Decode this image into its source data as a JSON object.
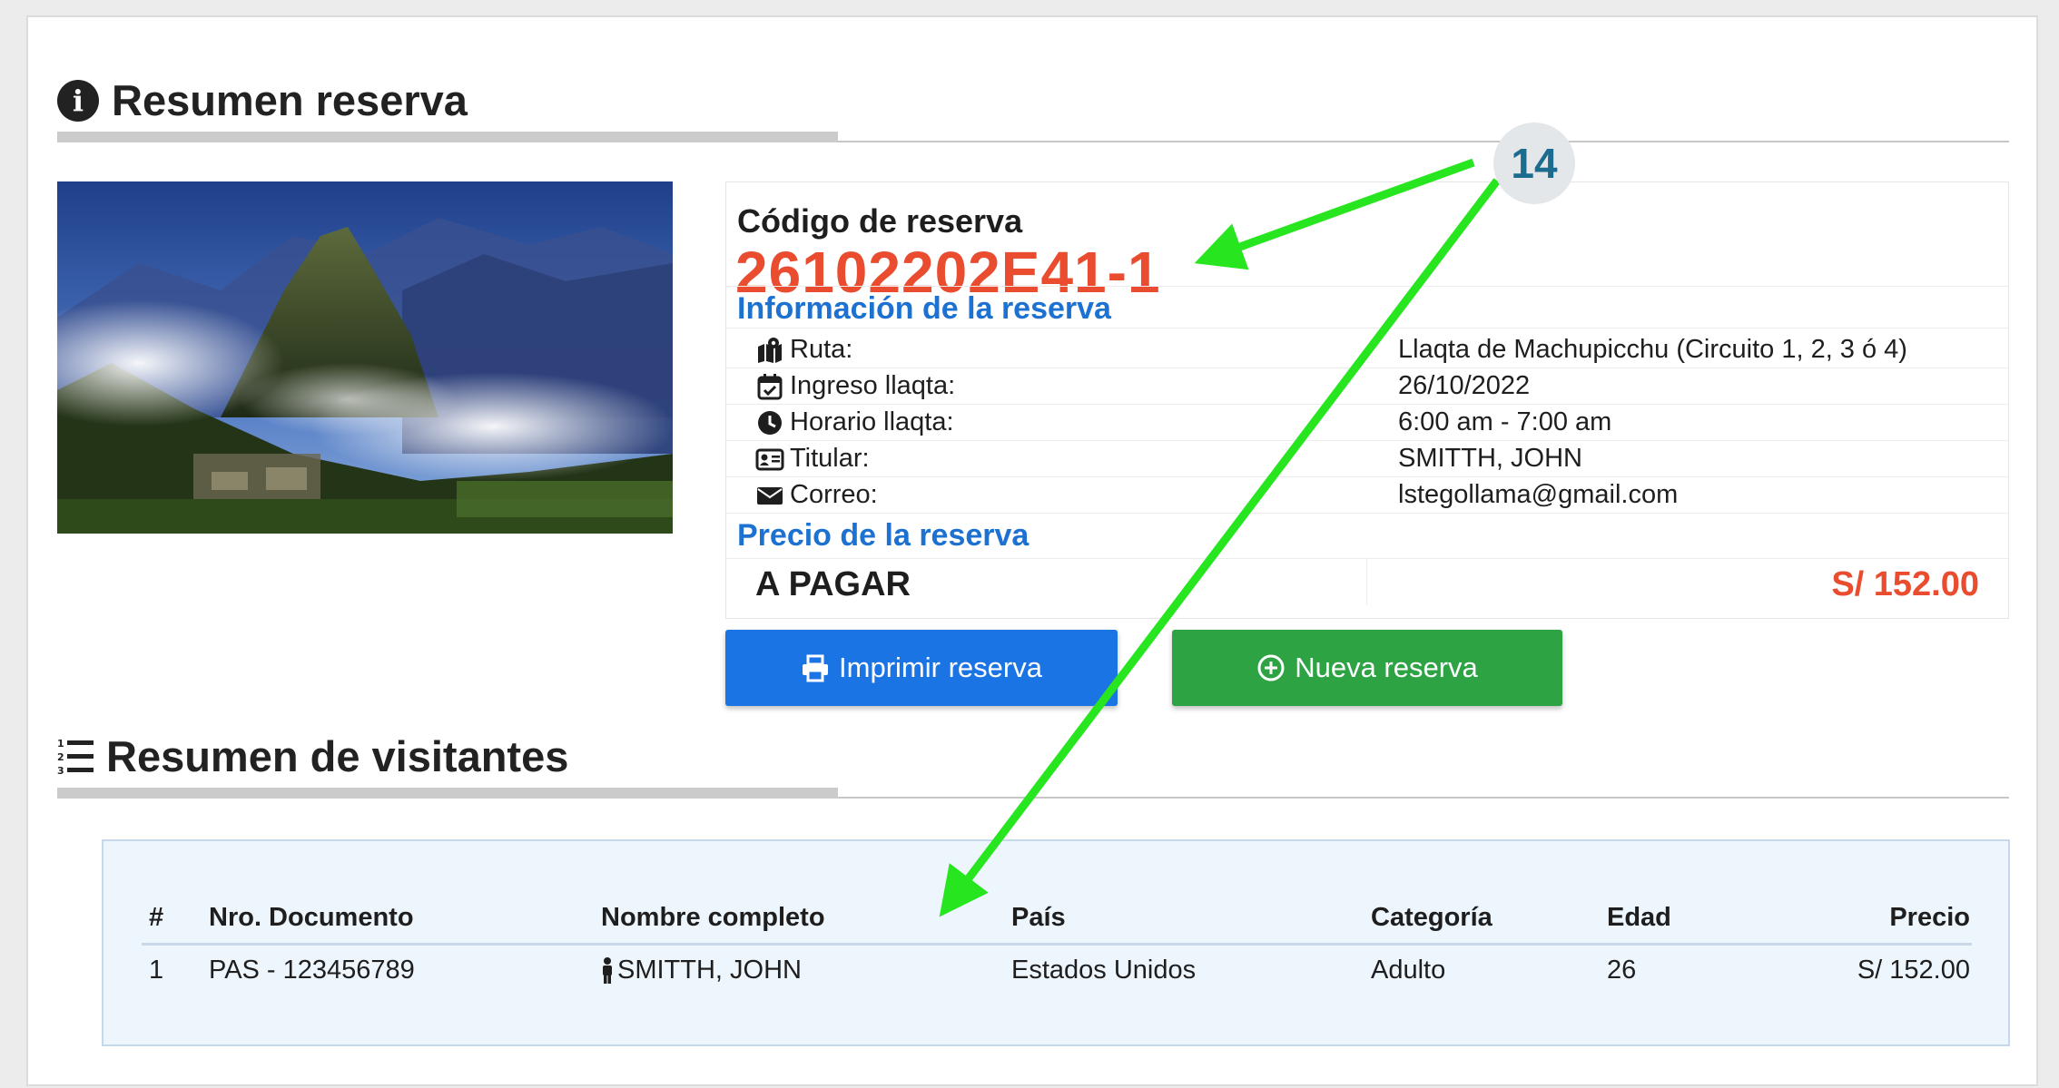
{
  "summary": {
    "title": "Resumen reserva",
    "code_label": "Código de reserva",
    "code_value": "26102202E41-1",
    "info_heading": "Información de la reserva",
    "rows": [
      {
        "label": "Ruta:",
        "value": "Llaqta de Machupicchu (Circuito 1, 2, 3 ó 4)",
        "icon": "map-route-icon"
      },
      {
        "label": "Ingreso llaqta:",
        "value": "26/10/2022",
        "icon": "calendar-check-icon"
      },
      {
        "label": "Horario llaqta:",
        "value": "6:00 am - 7:00 am",
        "icon": "clock-icon"
      },
      {
        "label": "Titular:",
        "value": "SMITTH, JOHN",
        "icon": "id-card-icon"
      },
      {
        "label": "Correo:",
        "value": "lstegollama@gmail.com",
        "icon": "envelope-icon"
      }
    ],
    "price_heading": "Precio de la reserva",
    "pay_label": "A PAGAR",
    "pay_value": "S/ 152.00"
  },
  "buttons": {
    "print_label": "Imprimir reserva",
    "new_label": "Nueva reserva",
    "print_color": "#1b74e4",
    "new_color": "#2ea343"
  },
  "visitors": {
    "title": "Resumen de visitantes",
    "columns": [
      "#",
      "Nro. Documento",
      "Nombre completo",
      "País",
      "Categoría",
      "Edad",
      "Precio"
    ],
    "rows": [
      {
        "num": "1",
        "document": "PAS - 123456789",
        "name": "SMITTH, JOHN",
        "country": "Estados Unidos",
        "category": "Adulto",
        "age": "26",
        "price": "S/ 152.00"
      }
    ]
  },
  "annotation": {
    "badge": "14",
    "arrow_color": "#27e620"
  },
  "colors": {
    "accent_red": "#ea4c2f",
    "heading_blue": "#1d72d1"
  }
}
